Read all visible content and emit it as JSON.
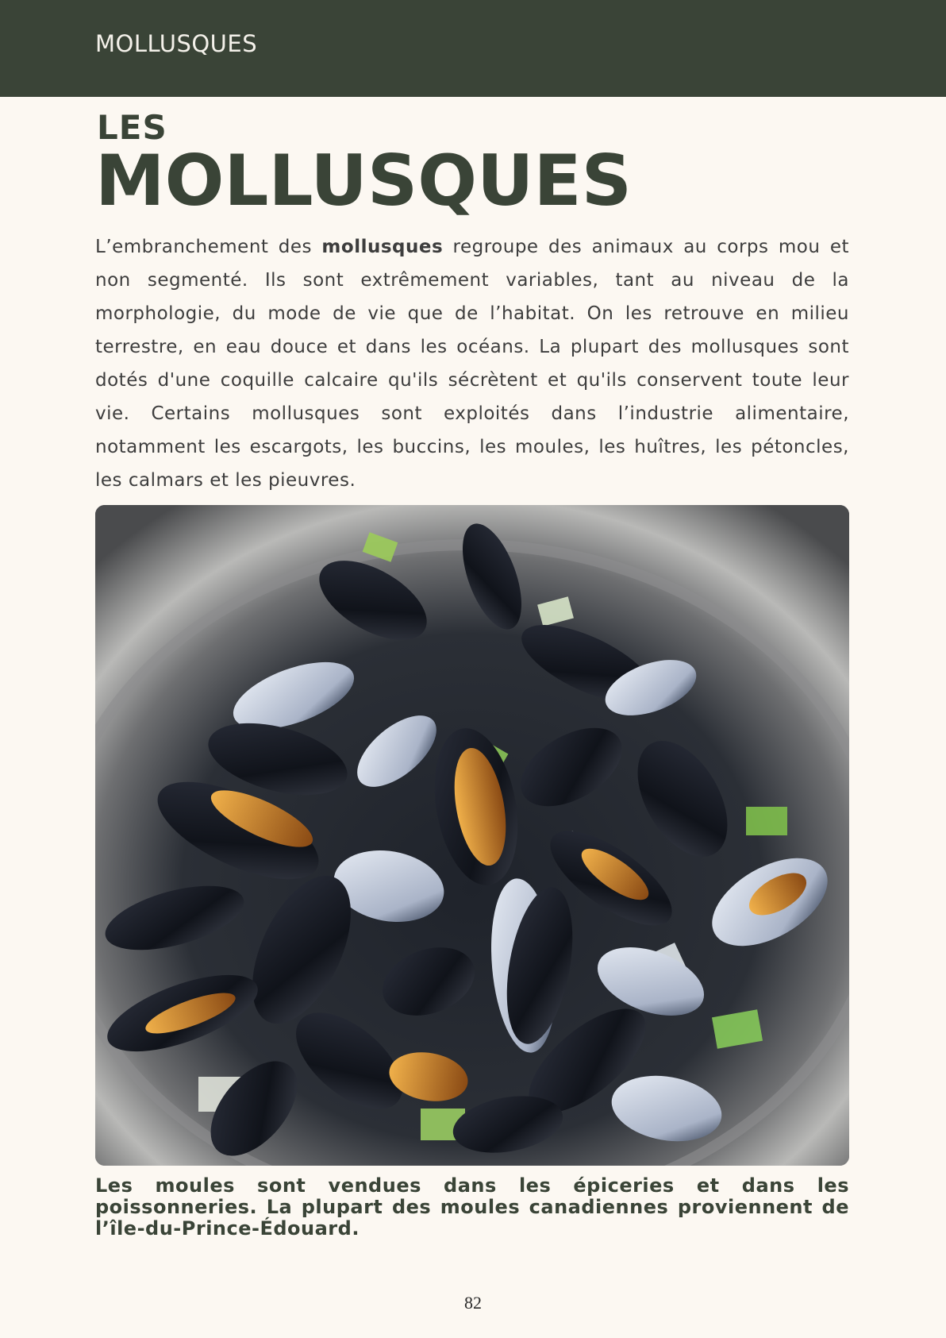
{
  "header": {
    "running_head": "MOLLUSQUES"
  },
  "title": {
    "small": "LES",
    "big": "MOLLUSQUES"
  },
  "intro": {
    "before_bold": "L’embranchement des ",
    "bold": "mollusques",
    "after_bold": " regroupe des animaux au corps mou et non segmenté. Ils sont extrêmement variables, tant au niveau de la morphologie, du mode de vie que de l’habitat. On les retrouve en milieu terrestre, en eau douce et dans les océans. La plupart des mollusques sont dotés d'une coquille calcaire qu'ils sécrètent et qu'ils conservent toute leur vie. Certains mollusques sont exploités dans l’industrie alimentaire, notamment les escargots, les buccins, les moules, les huîtres, les pétoncles, les calmars et les pieuvres."
  },
  "photo": {
    "subject": "mussels-in-pot"
  },
  "caption": "Les moules sont vendues dans les épiceries et dans les poissonneries. La plupart des moules canadiennes proviennent de l’île-du-Prince-Édouard.",
  "page_number": "82"
}
